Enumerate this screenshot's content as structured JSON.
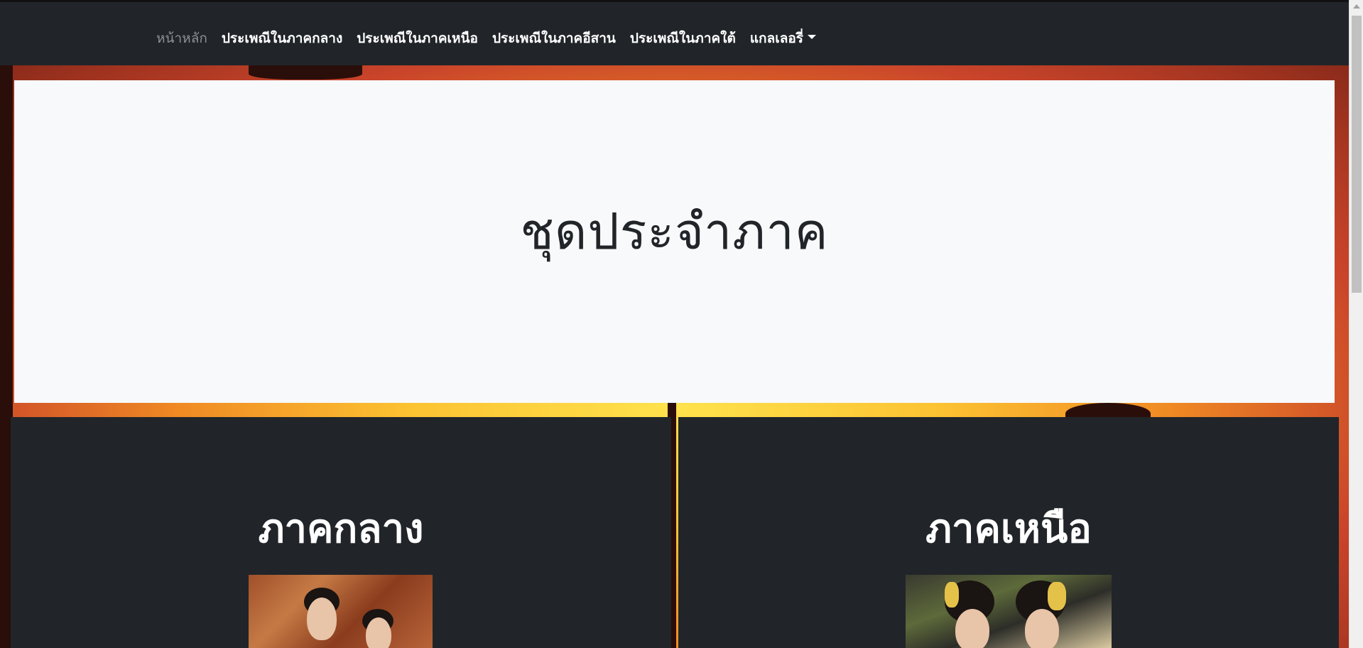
{
  "nav": {
    "items": [
      {
        "label": "หน้าหลัก",
        "active": false,
        "muted": true
      },
      {
        "label": "ประเพณีในภาคกลาง"
      },
      {
        "label": "ประเพณีในภาคเหนือ"
      },
      {
        "label": "ประเพณีในภาคอีสาน"
      },
      {
        "label": "ประเพณีในภาคใต้"
      },
      {
        "label": "แกลเลอรี่",
        "dropdown": true
      }
    ]
  },
  "hero": {
    "title": "ชุดประจำภาค"
  },
  "regions": [
    {
      "title": "ภาคกลาง"
    },
    {
      "title": "ภาคเหนือ"
    }
  ],
  "colors": {
    "navbar": "#212529",
    "hero_bg": "#f8f9fa",
    "card_bg": "#212529",
    "nav_muted": "#8c9095"
  }
}
